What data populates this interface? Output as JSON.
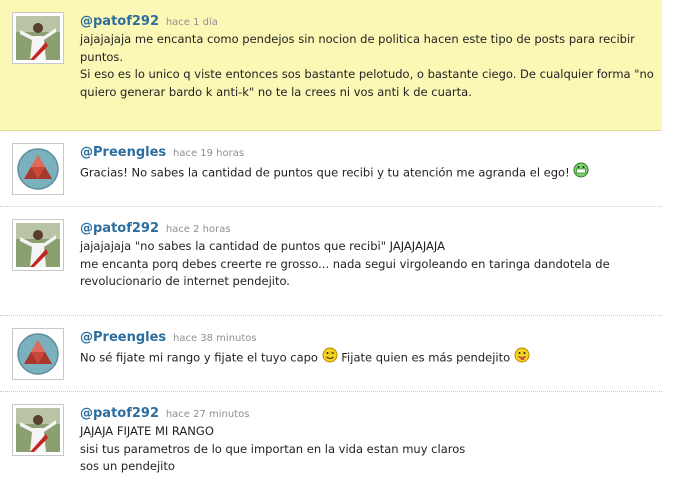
{
  "comments": [
    {
      "username": "@patof292",
      "time": "hace 1 día",
      "avatar": "player-photo",
      "highlighted": true,
      "lines": [
        "jajajajaja me encanta como pendejos sin nocion de politica hacen este tipo de posts para recibir puntos.",
        "Si eso es lo unico q viste entonces sos bastante pelotudo, o bastante ciego. De cualquier forma \"no quiero generar bardo k anti-k\" no te la crees ni vos anti k de cuarta."
      ]
    },
    {
      "username": "@Preengles",
      "time": "hace 19 horas",
      "avatar": "triangle-logo",
      "lines": [
        "Gracias! No sabes la cantidad de puntos que recibi y tu atención me agranda el ego!"
      ],
      "emoji": "grin-emoji"
    },
    {
      "username": "@patof292",
      "time": "hace 2 horas",
      "avatar": "player-photo",
      "lines": [
        "jajajajaja \"no sabes la cantidad de puntos que recibi\" JAJAJAJAJA",
        "me encanta porq debes creerte re grosso... nada segui virgoleando en taringa dandotela de revolucionario de internet pendejito."
      ]
    },
    {
      "username": "@Preengles",
      "time": "hace 38 minutos",
      "avatar": "triangle-logo",
      "parts": [
        "No sé fijate mi rango y fijate el tuyo capo",
        "Fijate quien es más pendejito"
      ],
      "emojis": [
        "wink-emoji",
        "tongue-emoji"
      ]
    },
    {
      "username": "@patof292",
      "time": "hace 27 minutos",
      "avatar": "player-photo",
      "lines": [
        "JAJAJA FIJATE MI RANGO",
        "sisi tus parametros de lo que importan en la vida estan muy claros",
        "sos un pendejito"
      ]
    }
  ],
  "colors": {
    "username": "#2d6e9f",
    "highlight": "#fbf8b6",
    "time": "#8f8f8f"
  }
}
